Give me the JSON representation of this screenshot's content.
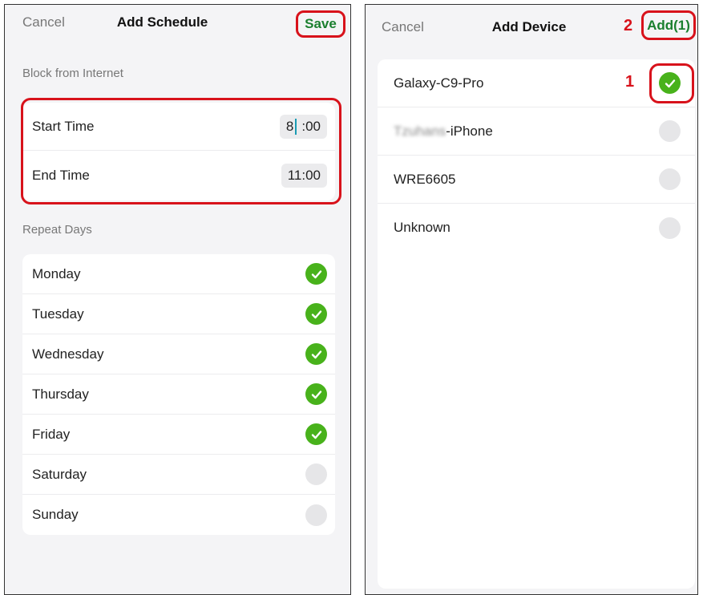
{
  "left_screen": {
    "nav": {
      "cancel": "Cancel",
      "title": "Add Schedule",
      "save": "Save"
    },
    "block_section_label": "Block from Internet",
    "start_time": {
      "label": "Start Time",
      "hour": "8",
      "minutes": ":00"
    },
    "end_time": {
      "label": "End Time",
      "value": "11:00"
    },
    "repeat_section_label": "Repeat Days",
    "days": [
      {
        "label": "Monday",
        "checked": true
      },
      {
        "label": "Tuesday",
        "checked": true
      },
      {
        "label": "Wednesday",
        "checked": true
      },
      {
        "label": "Thursday",
        "checked": true
      },
      {
        "label": "Friday",
        "checked": true
      },
      {
        "label": "Saturday",
        "checked": false
      },
      {
        "label": "Sunday",
        "checked": false
      }
    ]
  },
  "right_screen": {
    "nav": {
      "cancel": "Cancel",
      "title": "Add Device",
      "add": "Add(1)"
    },
    "annotation_step_2": "2",
    "annotation_step_1": "1",
    "devices": [
      {
        "label_prefix": "",
        "label": "Galaxy-C9-Pro",
        "checked": true
      },
      {
        "label_prefix": "Tzuhans",
        "label": "-iPhone",
        "checked": false
      },
      {
        "label_prefix": "",
        "label": "WRE6605",
        "checked": false
      },
      {
        "label_prefix": "",
        "label": "Unknown",
        "checked": false
      }
    ]
  },
  "colors": {
    "accent_green": "#48b21b",
    "save_green": "#1a7f2e",
    "annotation_red": "#d8121b"
  }
}
